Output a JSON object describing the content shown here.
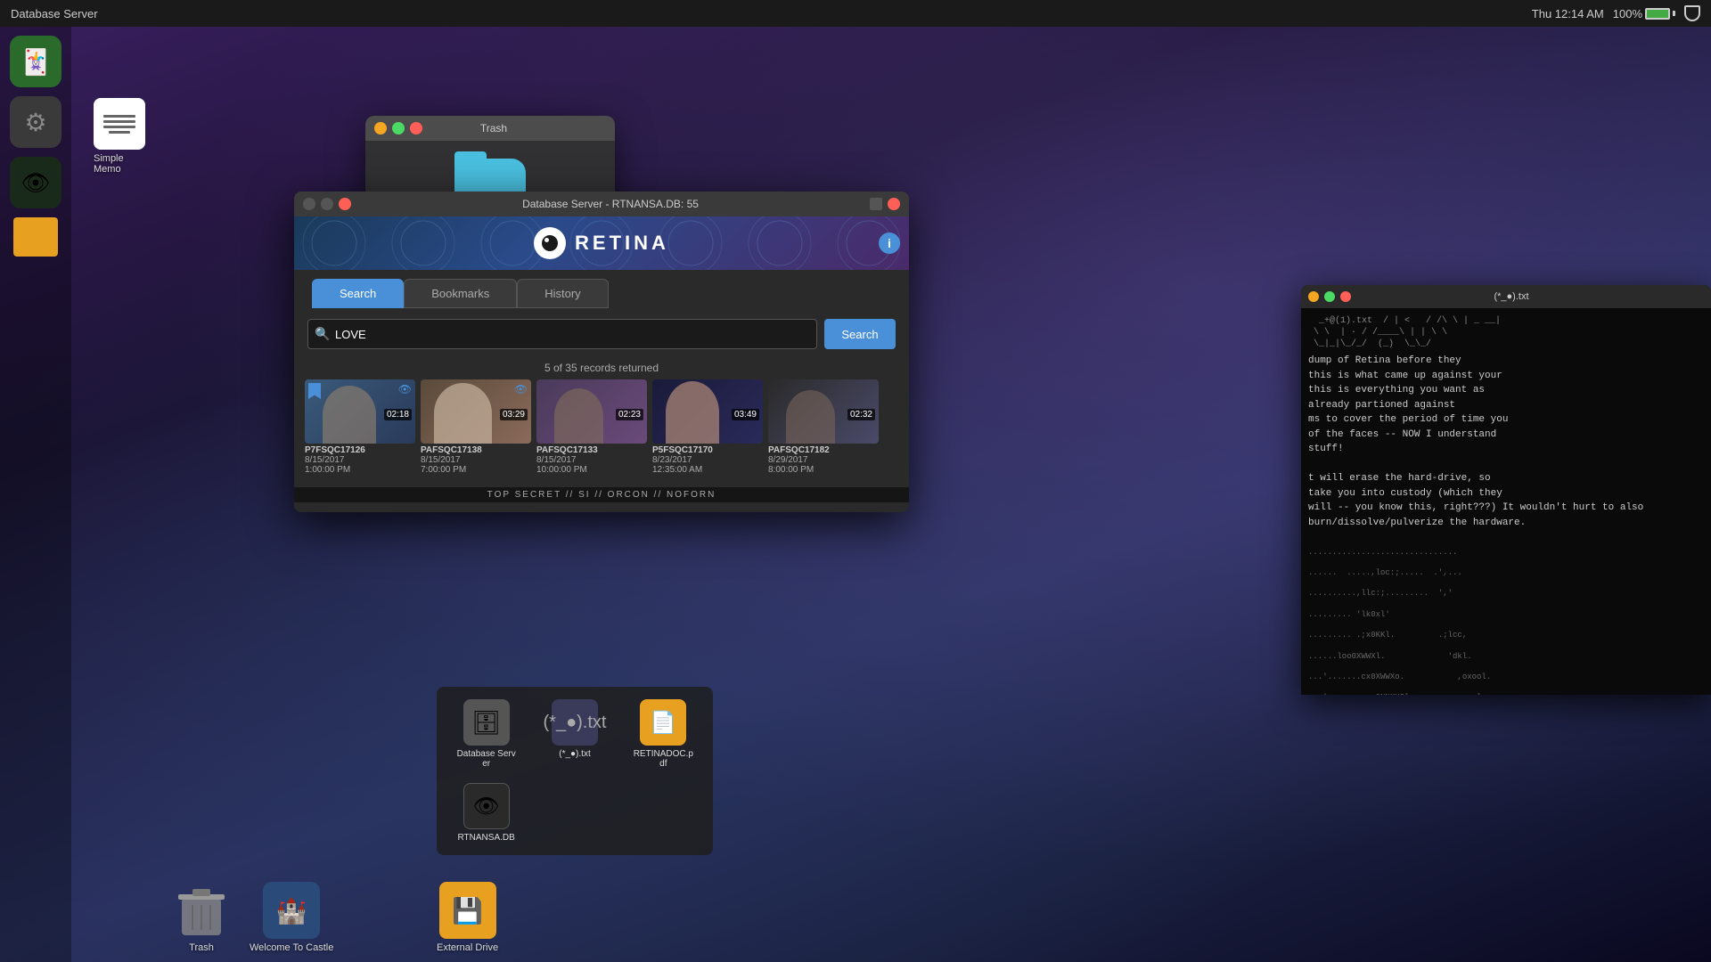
{
  "topbar": {
    "title": "Database Server",
    "time": "Thu 12:14 AM",
    "battery_pct": "100%"
  },
  "dock_left": {
    "icons": [
      {
        "name": "cards",
        "label": ""
      },
      {
        "name": "gears",
        "label": ""
      },
      {
        "name": "eye",
        "label": ""
      },
      {
        "name": "storage",
        "label": ""
      },
      {
        "name": "notepad",
        "label": "Simple Memo"
      }
    ]
  },
  "trash_window": {
    "title": "Trash",
    "controls": [
      "minimize",
      "expand",
      "close"
    ]
  },
  "db_window": {
    "title": "Database Server - RTNANSA.DB: 55",
    "logo": "RETINA",
    "tabs": [
      "Search",
      "Bookmarks",
      "History"
    ],
    "active_tab": "Search",
    "search_value": "LOVE",
    "search_btn": "Search",
    "results_info": "5 of 35 records returned",
    "results": [
      {
        "id": "P7FSQC17126",
        "date": "8/15/2017",
        "time": "1:00:00 PM",
        "duration": "02:18",
        "has_bookmark": true,
        "has_eye": true
      },
      {
        "id": "PAFSQC17138",
        "date": "8/15/2017",
        "time": "7:00:00 PM",
        "duration": "03:29",
        "has_bookmark": false,
        "has_eye": true
      },
      {
        "id": "PAFSQC17133",
        "date": "8/15/2017",
        "time": "10:00:00 PM",
        "duration": "02:23",
        "has_bookmark": false,
        "has_eye": false
      },
      {
        "id": "P5FSQC17170",
        "date": "8/23/2017",
        "time": "12:35:00 AM",
        "duration": "03:49",
        "has_bookmark": false,
        "has_eye": false
      },
      {
        "id": "PAFSQC17182",
        "date": "8/29/2017",
        "time": "8:00:00 PM",
        "duration": "02:32",
        "has_bookmark": false,
        "has_eye": false
      }
    ],
    "secret_bar": "TOP SECRET // SI // ORCON // NOFORN",
    "info_btn": "i"
  },
  "terminal": {
    "title": "(*_●).txt",
    "content_preview": "dump of Retina before they\nthis is what came up against your\nthis is everything you want as\nalready partioned against\nms to cover the period of time you\nof the faces -- NOW I understand\nstuff!\n\nt will erase the hard-drive, so\ntake you into custody (which they\nwill -- you know this, right???) It wouldn't hurt to also\nburn/dissolve/pulverize the hardware."
  },
  "desktop_files": [
    {
      "label": "Database Server",
      "icon": "db"
    },
    {
      "label": "(*_●).txt",
      "icon": "txt"
    },
    {
      "label": "RETINADOC.pdf",
      "icon": "pdf"
    },
    {
      "label": "RTNANSA.DB",
      "icon": "eye"
    }
  ],
  "bottom_dock": [
    {
      "label": "Trash",
      "icon": "trash"
    },
    {
      "label": "Welcome To Castle",
      "icon": "welcome"
    },
    {
      "label": "External Drive",
      "icon": "drive"
    }
  ]
}
